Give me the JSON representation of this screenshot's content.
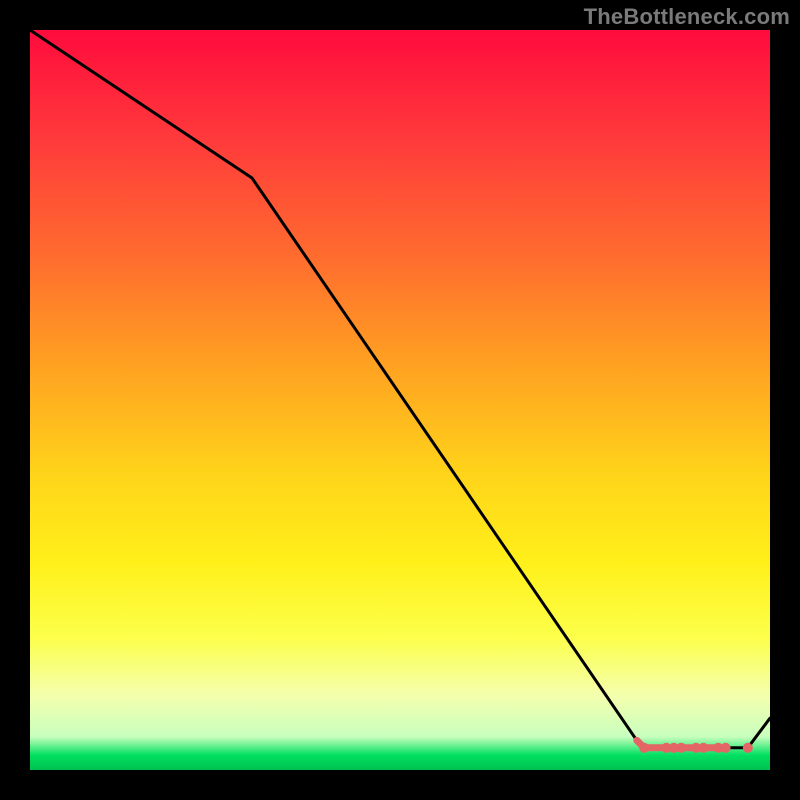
{
  "watermark": "TheBottleneck.com",
  "colors": {
    "line": "#000000",
    "marker": "#e46565",
    "plot_gradient_top": "#ff0b3d",
    "plot_gradient_bottom": "#00c050",
    "frame": "#000000"
  },
  "chart_data": {
    "type": "line",
    "title": "",
    "xlabel": "",
    "ylabel": "",
    "x_range": [
      0,
      100
    ],
    "y_range": [
      0,
      100
    ],
    "series": [
      {
        "name": "curve",
        "x": [
          0,
          30,
          82,
          83,
          85,
          86,
          87,
          88,
          89,
          90,
          91,
          92,
          93,
          94,
          97,
          100
        ],
        "y": [
          100,
          80,
          4,
          3,
          3,
          3,
          3,
          3,
          3,
          3,
          3,
          3,
          3,
          3,
          3,
          7
        ],
        "marker": [
          0,
          0,
          0,
          1,
          0,
          1,
          1,
          1,
          0,
          1,
          1,
          0,
          1,
          1,
          1,
          0
        ]
      }
    ],
    "notes": "Axes are unlabeled in the image; ranges are normalized 0-100. y represents vertical position of the black curve read from the gradient (100=top, 0=bottom). marker=1 indicates a visible pink dot on the flat segment."
  }
}
